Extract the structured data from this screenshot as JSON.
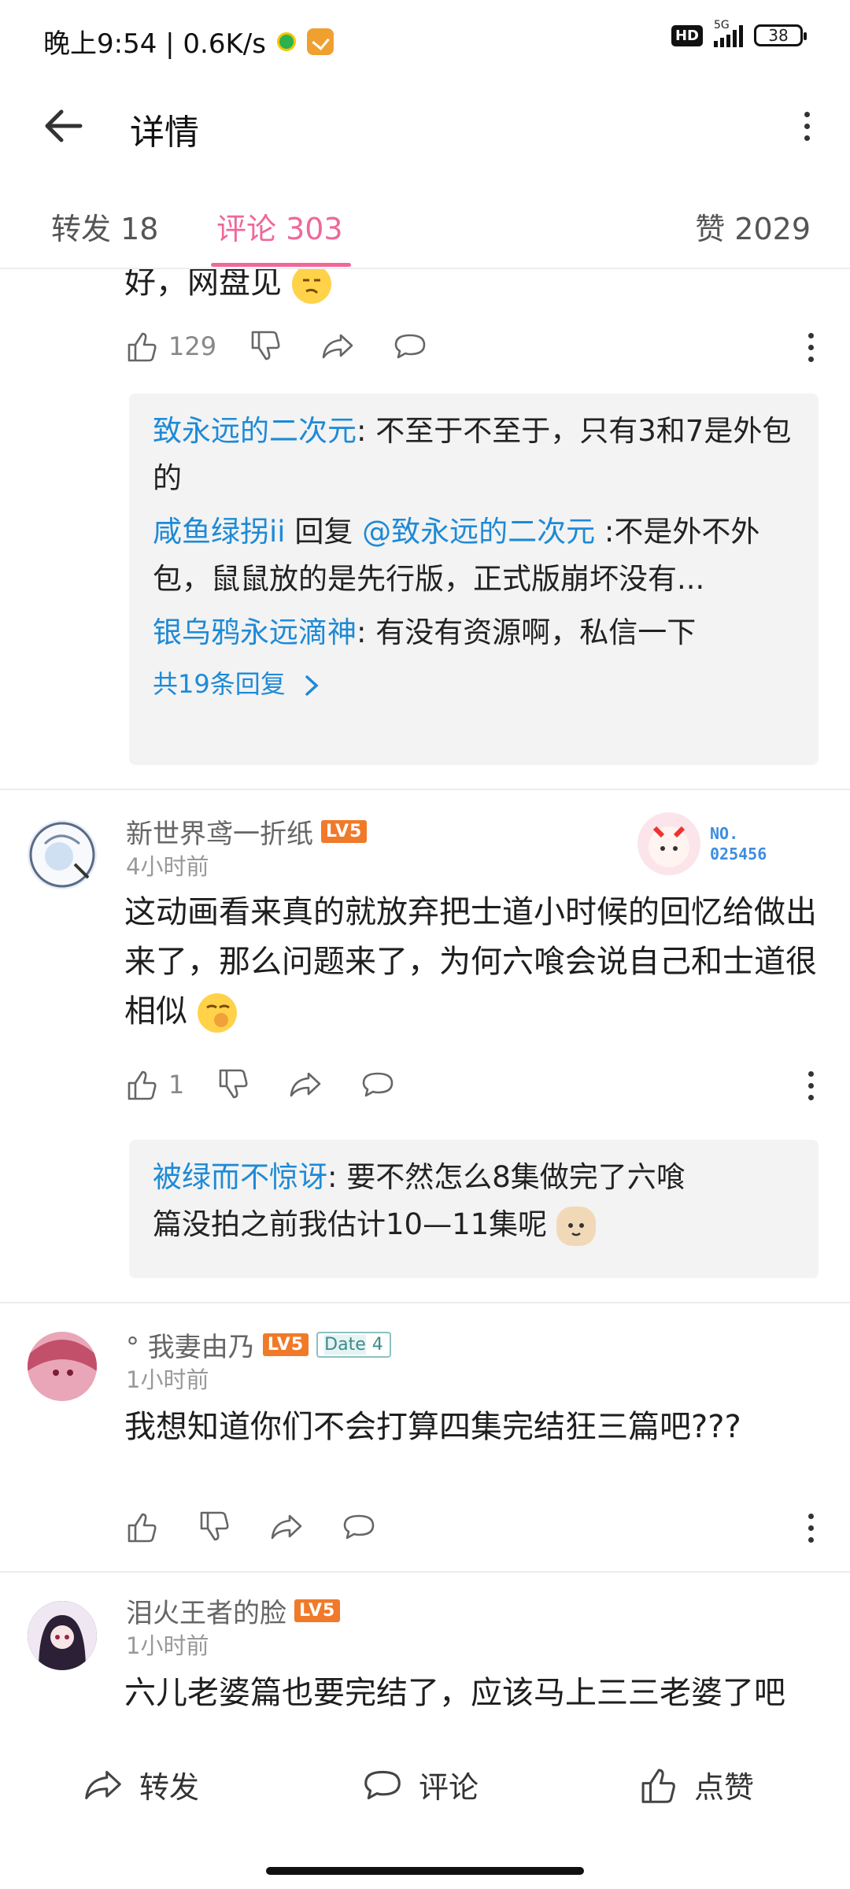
{
  "status_bar": {
    "time_and_speed": "晚上9:54 | 0.6K/s",
    "hd_label": "HD",
    "network_label": "5G",
    "battery": "38"
  },
  "header": {
    "title": "详情",
    "back_icon": "arrow-left-icon",
    "menu_icon": "more-vertical-icon"
  },
  "tabs": [
    {
      "label": "转发 18"
    },
    {
      "label": "评论 303",
      "active": true
    },
    {
      "label": "赞 2029"
    }
  ],
  "comments": [
    {
      "text_tail": "好，网盘见",
      "likes": "129",
      "replies": [
        {
          "name": "致永远的二次元",
          "sep": ": ",
          "text": "不至于不至于，只有3和7是外包的"
        },
        {
          "name": "咸鱼绿拐ii",
          "sep": " 回复 ",
          "mention": "@致永远的二次元",
          "text": " :不是外不外包，鼠鼠放的是先行版，正式版崩坏没有..."
        },
        {
          "name": "银乌鸦永远滴神",
          "sep": ": ",
          "text": "有没有资源啊，私信一下"
        }
      ],
      "more_replies": "共19条回复"
    },
    {
      "user": "新世界鸢一折纸",
      "level": "LV5",
      "time": "4小时前",
      "badge_no_label": "NO.",
      "badge_no_value": "025456",
      "text": "这动画看来真的就放弃把士道小时候的回忆给做出来了，那么问题来了，为何六喰会说自己和士道很相似",
      "likes": "1",
      "replies": [
        {
          "name": "被绿而不惊讶",
          "sep": ": ",
          "text": "要不然怎么8集做完了六喰篇没拍之前我估计10—11集呢"
        }
      ]
    },
    {
      "user": "°  我妻由乃",
      "level": "LV5",
      "date_badge": "Date",
      "date_badge_num": "4",
      "time": "1小时前",
      "text": "我想知道你们不会打算四集完结狂三篇吧???"
    },
    {
      "user": "泪火王者的脸",
      "level": "LV5",
      "time": "1小时前",
      "text": "六儿老婆篇也要完结了，应该马上三三老婆了吧"
    }
  ],
  "bottom_bar": {
    "share": "转发",
    "comment": "评论",
    "like": "点赞"
  },
  "colors": {
    "accent": "#f0679a",
    "link": "#1e8ad6",
    "level": "#f07a2a"
  }
}
